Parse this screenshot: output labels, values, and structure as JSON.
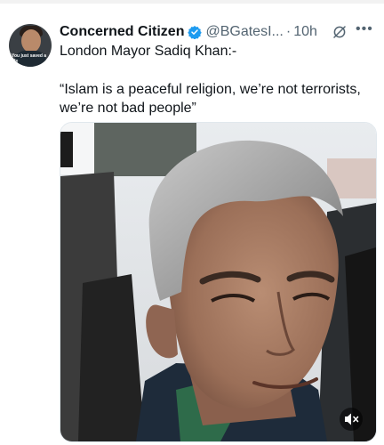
{
  "tweet": {
    "author_name": "Concerned Citizen",
    "handle": "@BGatesI...",
    "separator": "·",
    "time": "10h",
    "text_line1": "London Mayor Sadiq Khan:-",
    "quote": "“Islam is a peaceful religion, we’re not terrorists, we’re not bad people”",
    "avatar_text": "You just saved a life"
  },
  "icons": {
    "verified": "verified-badge-icon",
    "grok": "grok-icon",
    "more": "more-options-icon",
    "mute": "muted-speaker-icon"
  },
  "colors": {
    "verified": "#1d9bf0",
    "secondary_text": "#536471",
    "primary_text": "#0f1419"
  }
}
